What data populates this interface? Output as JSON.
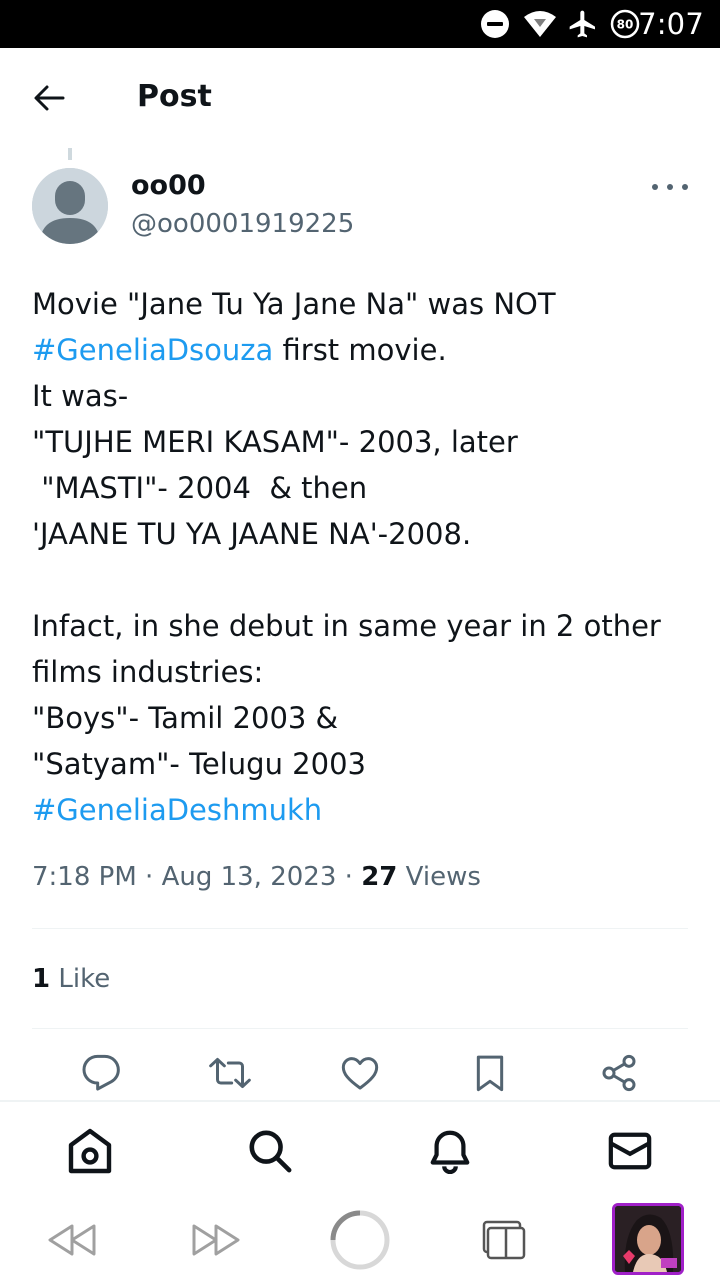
{
  "status_bar": {
    "time": "7:07",
    "battery_level": "80",
    "icons": [
      "dnd-icon",
      "wifi-icon",
      "airplane-icon",
      "battery-icon"
    ]
  },
  "header": {
    "title": "Post",
    "back_icon": "arrow-left-icon"
  },
  "post": {
    "author_name": "oo00",
    "author_handle": "@oo0001919225",
    "lines": [
      [
        {
          "t": "Movie \"Jane Tu Ya Jane Na\" was NOT"
        }
      ],
      [
        {
          "t": "#GeneliaDsouza",
          "tag": true
        },
        {
          "t": " first movie."
        }
      ],
      [
        {
          "t": "It was-"
        }
      ],
      [
        {
          "t": "\"TUJHE MERI KASAM\"- 2003, later"
        }
      ],
      [
        {
          "t": " \"MASTI\"- 2004  & then"
        }
      ],
      [
        {
          "t": "'JAANE TU YA JAANE NA'-2008."
        }
      ],
      [
        {
          "t": ""
        }
      ],
      [
        {
          "t": "Infact, in she debut in same year in 2 other"
        }
      ],
      [
        {
          "t": "films industries:"
        }
      ],
      [
        {
          "t": "\"Boys\"- Tamil 2003 &"
        }
      ],
      [
        {
          "t": "\"Satyam\"- Telugu 2003"
        }
      ],
      [
        {
          "t": "#GeneliaDeshmukh",
          "tag": true
        }
      ]
    ],
    "time": "7:18 PM",
    "date": "Aug 13, 2023",
    "views_count": "27",
    "views_label": "Views",
    "likes_count": "1",
    "likes_label": "Like"
  },
  "actions": [
    "reply-icon",
    "repost-icon",
    "like-icon",
    "bookmark-icon",
    "share-icon"
  ],
  "bottom_nav": [
    "home-icon",
    "search-icon",
    "notifications-icon",
    "messages-icon"
  ],
  "browser_bar": [
    "back-icon",
    "forward-icon",
    "reload-icon",
    "tabs-icon",
    "profile-thumbnail"
  ],
  "colors": {
    "accent": "#1d9bf0",
    "text": "#0f1419",
    "secondary_text": "#536471",
    "divider": "#eff3f4",
    "profile_border": "#a020c8"
  }
}
